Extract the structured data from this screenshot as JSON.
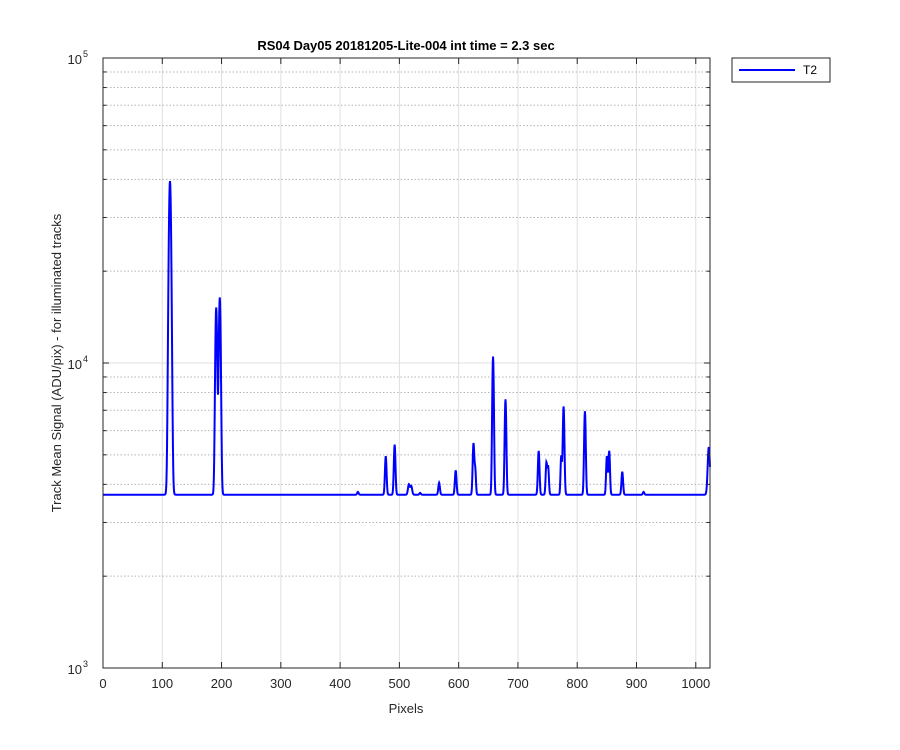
{
  "chart_data": {
    "type": "line",
    "title": "RS04 Day05 20181205-Lite-004 int time = 2.3 sec",
    "xlabel": "Pixels",
    "ylabel": "Track Mean Signal (ADU/pix) - for illuminated tracks",
    "xlim": [
      0,
      1024
    ],
    "ylim": [
      1000,
      100000
    ],
    "yscale": "log",
    "grid": true,
    "minor_grid": true,
    "legend_position": "outside-top-right",
    "x_ticks": [
      "0",
      "100",
      "200",
      "300",
      "400",
      "500",
      "600",
      "700",
      "800",
      "900",
      "1000"
    ],
    "y_ticks": [
      {
        "base": "10",
        "exp": "3"
      },
      {
        "base": "10",
        "exp": "4"
      },
      {
        "base": "10",
        "exp": "5"
      }
    ],
    "series": [
      {
        "name": "T2",
        "color": "#0000ff",
        "baseline": 3700,
        "peaks": [
          {
            "x": 113,
            "y": 39500,
            "w": 2.0
          },
          {
            "x": 191,
            "y": 15200,
            "w": 1.6
          },
          {
            "x": 197,
            "y": 16400,
            "w": 1.6
          },
          {
            "x": 430,
            "y": 3780,
            "w": 1.2
          },
          {
            "x": 477,
            "y": 4950,
            "w": 1.3
          },
          {
            "x": 492,
            "y": 5400,
            "w": 1.3
          },
          {
            "x": 516,
            "y": 4000,
            "w": 1.5
          },
          {
            "x": 520,
            "y": 3950,
            "w": 1.5
          },
          {
            "x": 535,
            "y": 3750,
            "w": 1.2
          },
          {
            "x": 567,
            "y": 4050,
            "w": 1.3
          },
          {
            "x": 595,
            "y": 4450,
            "w": 1.3
          },
          {
            "x": 625,
            "y": 5450,
            "w": 1.3
          },
          {
            "x": 628,
            "y": 4450,
            "w": 1.1
          },
          {
            "x": 658,
            "y": 10500,
            "w": 1.3
          },
          {
            "x": 679,
            "y": 7600,
            "w": 1.3
          },
          {
            "x": 735,
            "y": 5150,
            "w": 1.3
          },
          {
            "x": 748,
            "y": 4700,
            "w": 1.2
          },
          {
            "x": 751,
            "y": 4550,
            "w": 1.2
          },
          {
            "x": 773,
            "y": 4950,
            "w": 1.1
          },
          {
            "x": 777,
            "y": 7200,
            "w": 1.3
          },
          {
            "x": 813,
            "y": 6950,
            "w": 1.3
          },
          {
            "x": 850,
            "y": 4950,
            "w": 1.2
          },
          {
            "x": 854,
            "y": 5150,
            "w": 1.2
          },
          {
            "x": 876,
            "y": 4400,
            "w": 1.3
          },
          {
            "x": 912,
            "y": 3780,
            "w": 1.2
          },
          {
            "x": 1022,
            "y": 5300,
            "w": 1.8
          }
        ]
      }
    ]
  }
}
